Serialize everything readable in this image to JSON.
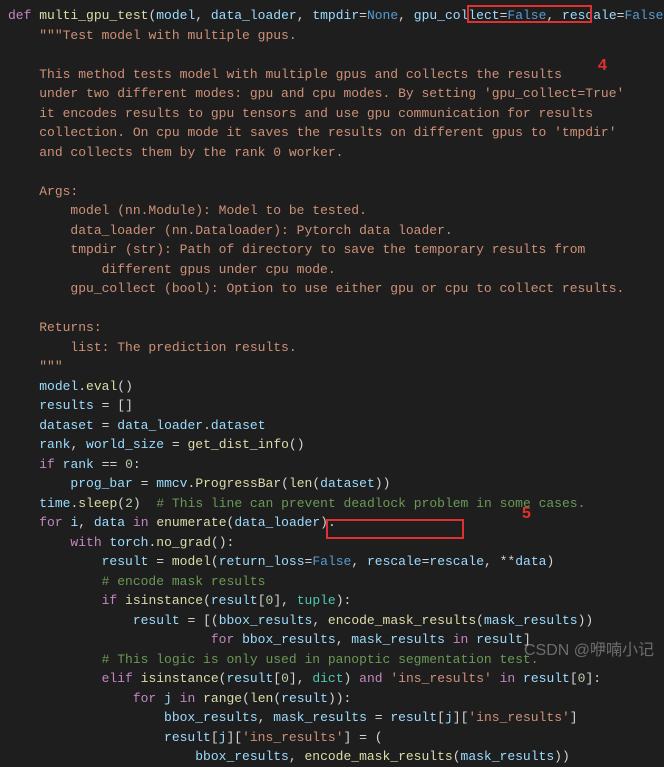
{
  "function": {
    "def_kw": "def",
    "name": "multi_gpu_test",
    "params": {
      "p1": "model",
      "p2": "data_loader",
      "p3": "tmpdir",
      "p3_default": "None",
      "p4": "gpu_collect",
      "p4_default": "False",
      "p5": "rescale",
      "p5_default": "False"
    }
  },
  "docstring": {
    "open": "\"\"\"",
    "title": "Test model with multiple gpus.",
    "body1": "This method tests model with multiple gpus and collects the results",
    "body2": "under two different modes: gpu and cpu modes. By setting 'gpu_collect=True'",
    "body3": "it encodes results to gpu tensors and use gpu communication for results",
    "body4": "collection. On cpu mode it saves the results on different gpus to 'tmpdir'",
    "body5": "and collects them by the rank 0 worker.",
    "args_header": "Args:",
    "args1": "model (nn.Module): Model to be tested.",
    "args2": "data_loader (nn.Dataloader): Pytorch data loader.",
    "args3a": "tmpdir (str): Path of directory to save the temporary results from",
    "args3b": "different gpus under cpu mode.",
    "args4": "gpu_collect (bool): Option to use either gpu or cpu to collect results.",
    "returns_header": "Returns:",
    "returns1": "list: The prediction results.",
    "close": "\"\"\""
  },
  "code": {
    "l1a": "model",
    "l1b": "eval",
    "l2a": "results",
    "l3a": "dataset",
    "l3b": "data_loader",
    "l3c": "dataset",
    "l4a": "rank",
    "l4b": "world_size",
    "l4c": "get_dist_info",
    "l5kw": "if",
    "l5a": "rank",
    "l5b": "0",
    "l6a": "prog_bar",
    "l6b": "mmcv",
    "l6c": "ProgressBar",
    "l6d": "len",
    "l6e": "dataset",
    "l7a": "time",
    "l7b": "sleep",
    "l7c": "2",
    "l7cmt": "# This line can prevent deadlock problem in some cases.",
    "l8kw": "for",
    "l8a": "i",
    "l8b": "data",
    "l8in": "in",
    "l8c": "enumerate",
    "l8d": "data_loader",
    "l9kw": "with",
    "l9a": "torch",
    "l9b": "no_grad",
    "l10a": "result",
    "l10b": "model",
    "l10c": "return_loss",
    "l10d": "False",
    "l10e": "rescale",
    "l10f": "rescale",
    "l10g": "data",
    "l11cmt": "# encode mask results",
    "l12kw": "if",
    "l12a": "isinstance",
    "l12b": "result",
    "l12c": "0",
    "l12d": "tuple",
    "l13a": "result",
    "l13b": "bbox_results",
    "l13c": "encode_mask_results",
    "l13d": "mask_results",
    "l14kw": "for",
    "l14a": "bbox_results",
    "l14b": "mask_results",
    "l14in": "in",
    "l14c": "result",
    "l15cmt": "# This logic is only used in panoptic segmentation test.",
    "l16kw": "elif",
    "l16a": "isinstance",
    "l16b": "result",
    "l16c": "0",
    "l16d": "dict",
    "l16and": "and",
    "l16e": "'ins_results'",
    "l16in": "in",
    "l16f": "result",
    "l16g": "0",
    "l17kw": "for",
    "l17a": "j",
    "l17in": "in",
    "l17b": "range",
    "l17c": "len",
    "l17d": "result",
    "l18a": "bbox_results",
    "l18b": "mask_results",
    "l18c": "result",
    "l18d": "j",
    "l18e": "'ins_results'",
    "l19a": "result",
    "l19b": "j",
    "l19c": "'ins_results'",
    "l20a": "bbox_results",
    "l20b": "encode_mask_results",
    "l20c": "mask_results"
  },
  "annotations": {
    "label4": "4",
    "label5": "5"
  },
  "watermark": "CSDN @咿喃小记"
}
